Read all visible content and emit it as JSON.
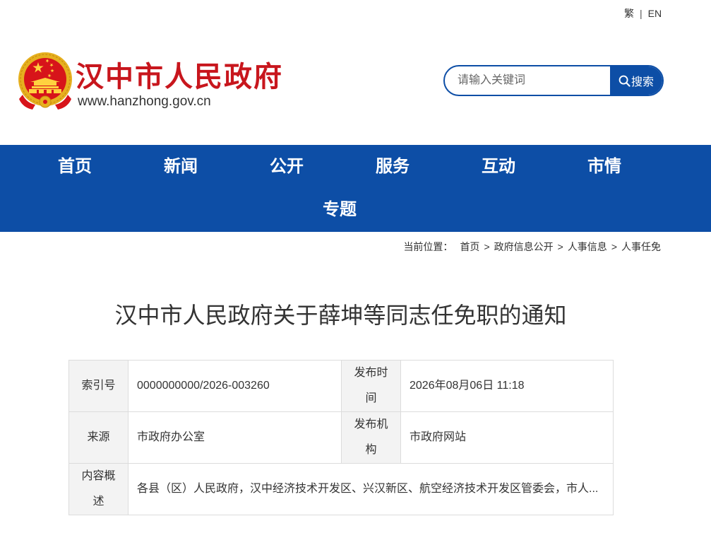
{
  "theme": {
    "primary": "#0d4ea6",
    "brand_red": "#c8161d"
  },
  "header": {
    "lang": {
      "traditional": "繁",
      "separator": "|",
      "english": "EN"
    },
    "site_title": "汉中市人民政府",
    "site_url": "www.hanzhong.gov.cn",
    "search": {
      "placeholder": "请输入关键词",
      "button_label": "搜索",
      "button_icon": "search-icon"
    },
    "logo_icon": "national-emblem-icon"
  },
  "nav": {
    "items": [
      {
        "label": "首页"
      },
      {
        "label": "新闻"
      },
      {
        "label": "公开"
      },
      {
        "label": "服务"
      },
      {
        "label": "互动"
      },
      {
        "label": "市情"
      },
      {
        "label": "专题"
      }
    ]
  },
  "breadcrumb": {
    "label": "当前位置：",
    "separator": ">",
    "items": [
      "首页",
      "政府信息公开",
      "人事信息",
      "人事任免"
    ]
  },
  "article": {
    "title": "汉中市人民政府关于薛坤等同志任免职的通知",
    "meta": {
      "index_no": {
        "label": "索引号",
        "value": "0000000000/2026-003260"
      },
      "publish_time": {
        "label": "发布时间",
        "value": "2026年08月06日 11:18"
      },
      "source": {
        "label": "来源",
        "value": "市政府办公室"
      },
      "publisher": {
        "label": "发布机构",
        "value": "市政府网站"
      },
      "summary": {
        "label": "内容概述",
        "value": "各县（区）人民政府，汉中经济技术开发区、兴汉新区、航空经济技术开发区管委会，市人..."
      }
    }
  }
}
